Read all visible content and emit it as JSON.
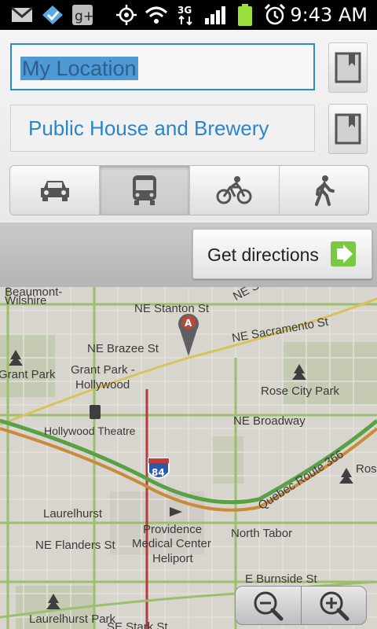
{
  "status_bar": {
    "time": "9:43 AM",
    "icons": [
      "gmail-icon",
      "foursquare-icon",
      "google-plus-icon",
      "gps-icon",
      "wifi-icon",
      "3g-icon",
      "signal-icon",
      "battery-icon",
      "alarm-icon"
    ]
  },
  "directions": {
    "start_value": "My Location",
    "end_value": "Public House and Brewery",
    "modes": [
      "car",
      "transit",
      "bicycle",
      "walk"
    ],
    "active_mode": "transit",
    "get_directions_label": "Get directions",
    "accent": "#2b86c8",
    "go_arrow_color": "#7ac943"
  },
  "map": {
    "marker_label": "A",
    "labels": {
      "wilshire": "Wilshire",
      "beaumont": "Beaumont-",
      "stanton": "NE Stanton St",
      "sandy": "NE Sandy Blvd",
      "brazee": "NE Brazee St",
      "sacramento": "NE Sacramento St",
      "grant_park_frag": "Grant Park",
      "grant_park_hollywood_1": "Grant Park -",
      "grant_park_hollywood_2": "Hollywood",
      "rose_city_park": "Rose City Park",
      "broadway": "NE Broadway",
      "hollywood_theatre": "Hollywood Theatre",
      "quebec": "Quebec Route 366",
      "rose_frag": "Rose",
      "i84": "84",
      "laurelhurst": "Laurelhurst",
      "providence_1": "Providence",
      "providence_2": "Medical Center",
      "providence_3": "Heliport",
      "north_tabor": "North Tabor",
      "flanders": "NE Flanders St",
      "burnside": "E Burnside St",
      "laurelhurst_park": "Laurelhurst Park",
      "stark": "SE Stark St"
    }
  }
}
